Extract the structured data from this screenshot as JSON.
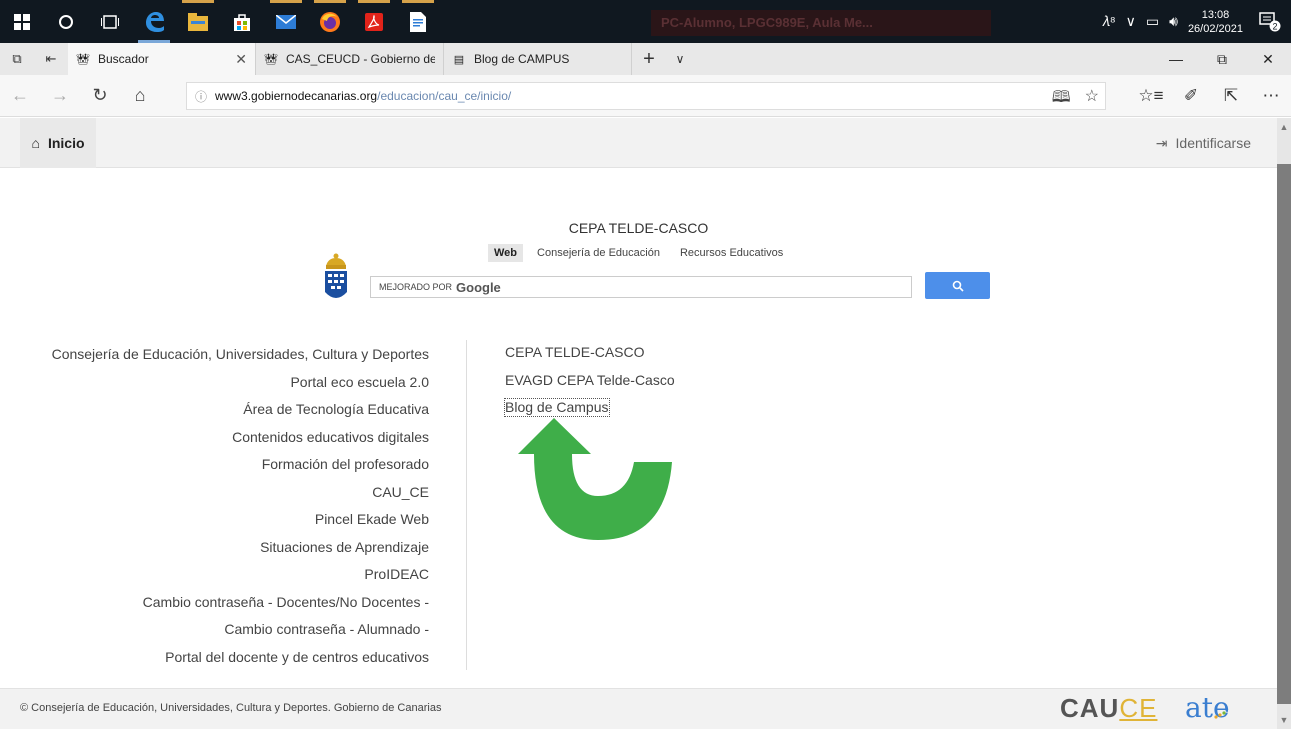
{
  "taskbar": {
    "icons": [
      "windows-start",
      "search-circle",
      "task-view",
      "edge",
      "file-explorer",
      "store",
      "mail",
      "firefox",
      "acrobat",
      "document"
    ],
    "ghost_text": "PC-Alumno, LPGC989E, Aula Me...",
    "time": "13:08",
    "date": "26/02/2021",
    "notification_count": "2"
  },
  "tabs": [
    {
      "label": "Buscador",
      "active": true
    },
    {
      "label": "CAS_CEUCD - Gobierno de",
      "active": false
    },
    {
      "label": "Blog de CAMPUS",
      "active": false
    }
  ],
  "address": {
    "host": "www3.gobiernodecanarias.org",
    "path": "/educacion/cau_ce/inicio/"
  },
  "header": {
    "home": "Inicio",
    "login": "Identificarse"
  },
  "search": {
    "site_title": "CEPA TELDE-CASCO",
    "tabs": [
      "Web",
      "Consejería de Educación",
      "Recursos Educativos"
    ],
    "placeholder_prefix": "MEJORADO POR",
    "google": "Google"
  },
  "left_links": [
    "Consejería de Educación, Universidades, Cultura y Deportes",
    "Portal eco escuela 2.0",
    "Área de Tecnología Educativa",
    "Contenidos educativos digitales",
    "Formación del profesorado",
    "CAU_CE",
    "Pincel Ekade Web",
    "Situaciones de Aprendizaje",
    "ProIDEAC",
    "Cambio contraseña - Docentes/No Docentes -",
    "Cambio contraseña - Alumnado -",
    "Portal del docente y de centros educativos"
  ],
  "right_links": [
    "CEPA TELDE-CASCO",
    "EVAGD CEPA Telde-Casco",
    "Blog de Campus"
  ],
  "footer": {
    "text": "© Consejería de Educación, Universidades, Cultura y Deportes.  Gobierno de Canarias",
    "cauce": "CAU",
    "cauce_suffix": "CE",
    "ate": "ate"
  },
  "colors": {
    "taskbar": "#101820",
    "search_button": "#4d8fea",
    "arrow": "#3fae49",
    "url_path": "#6a88b0"
  }
}
